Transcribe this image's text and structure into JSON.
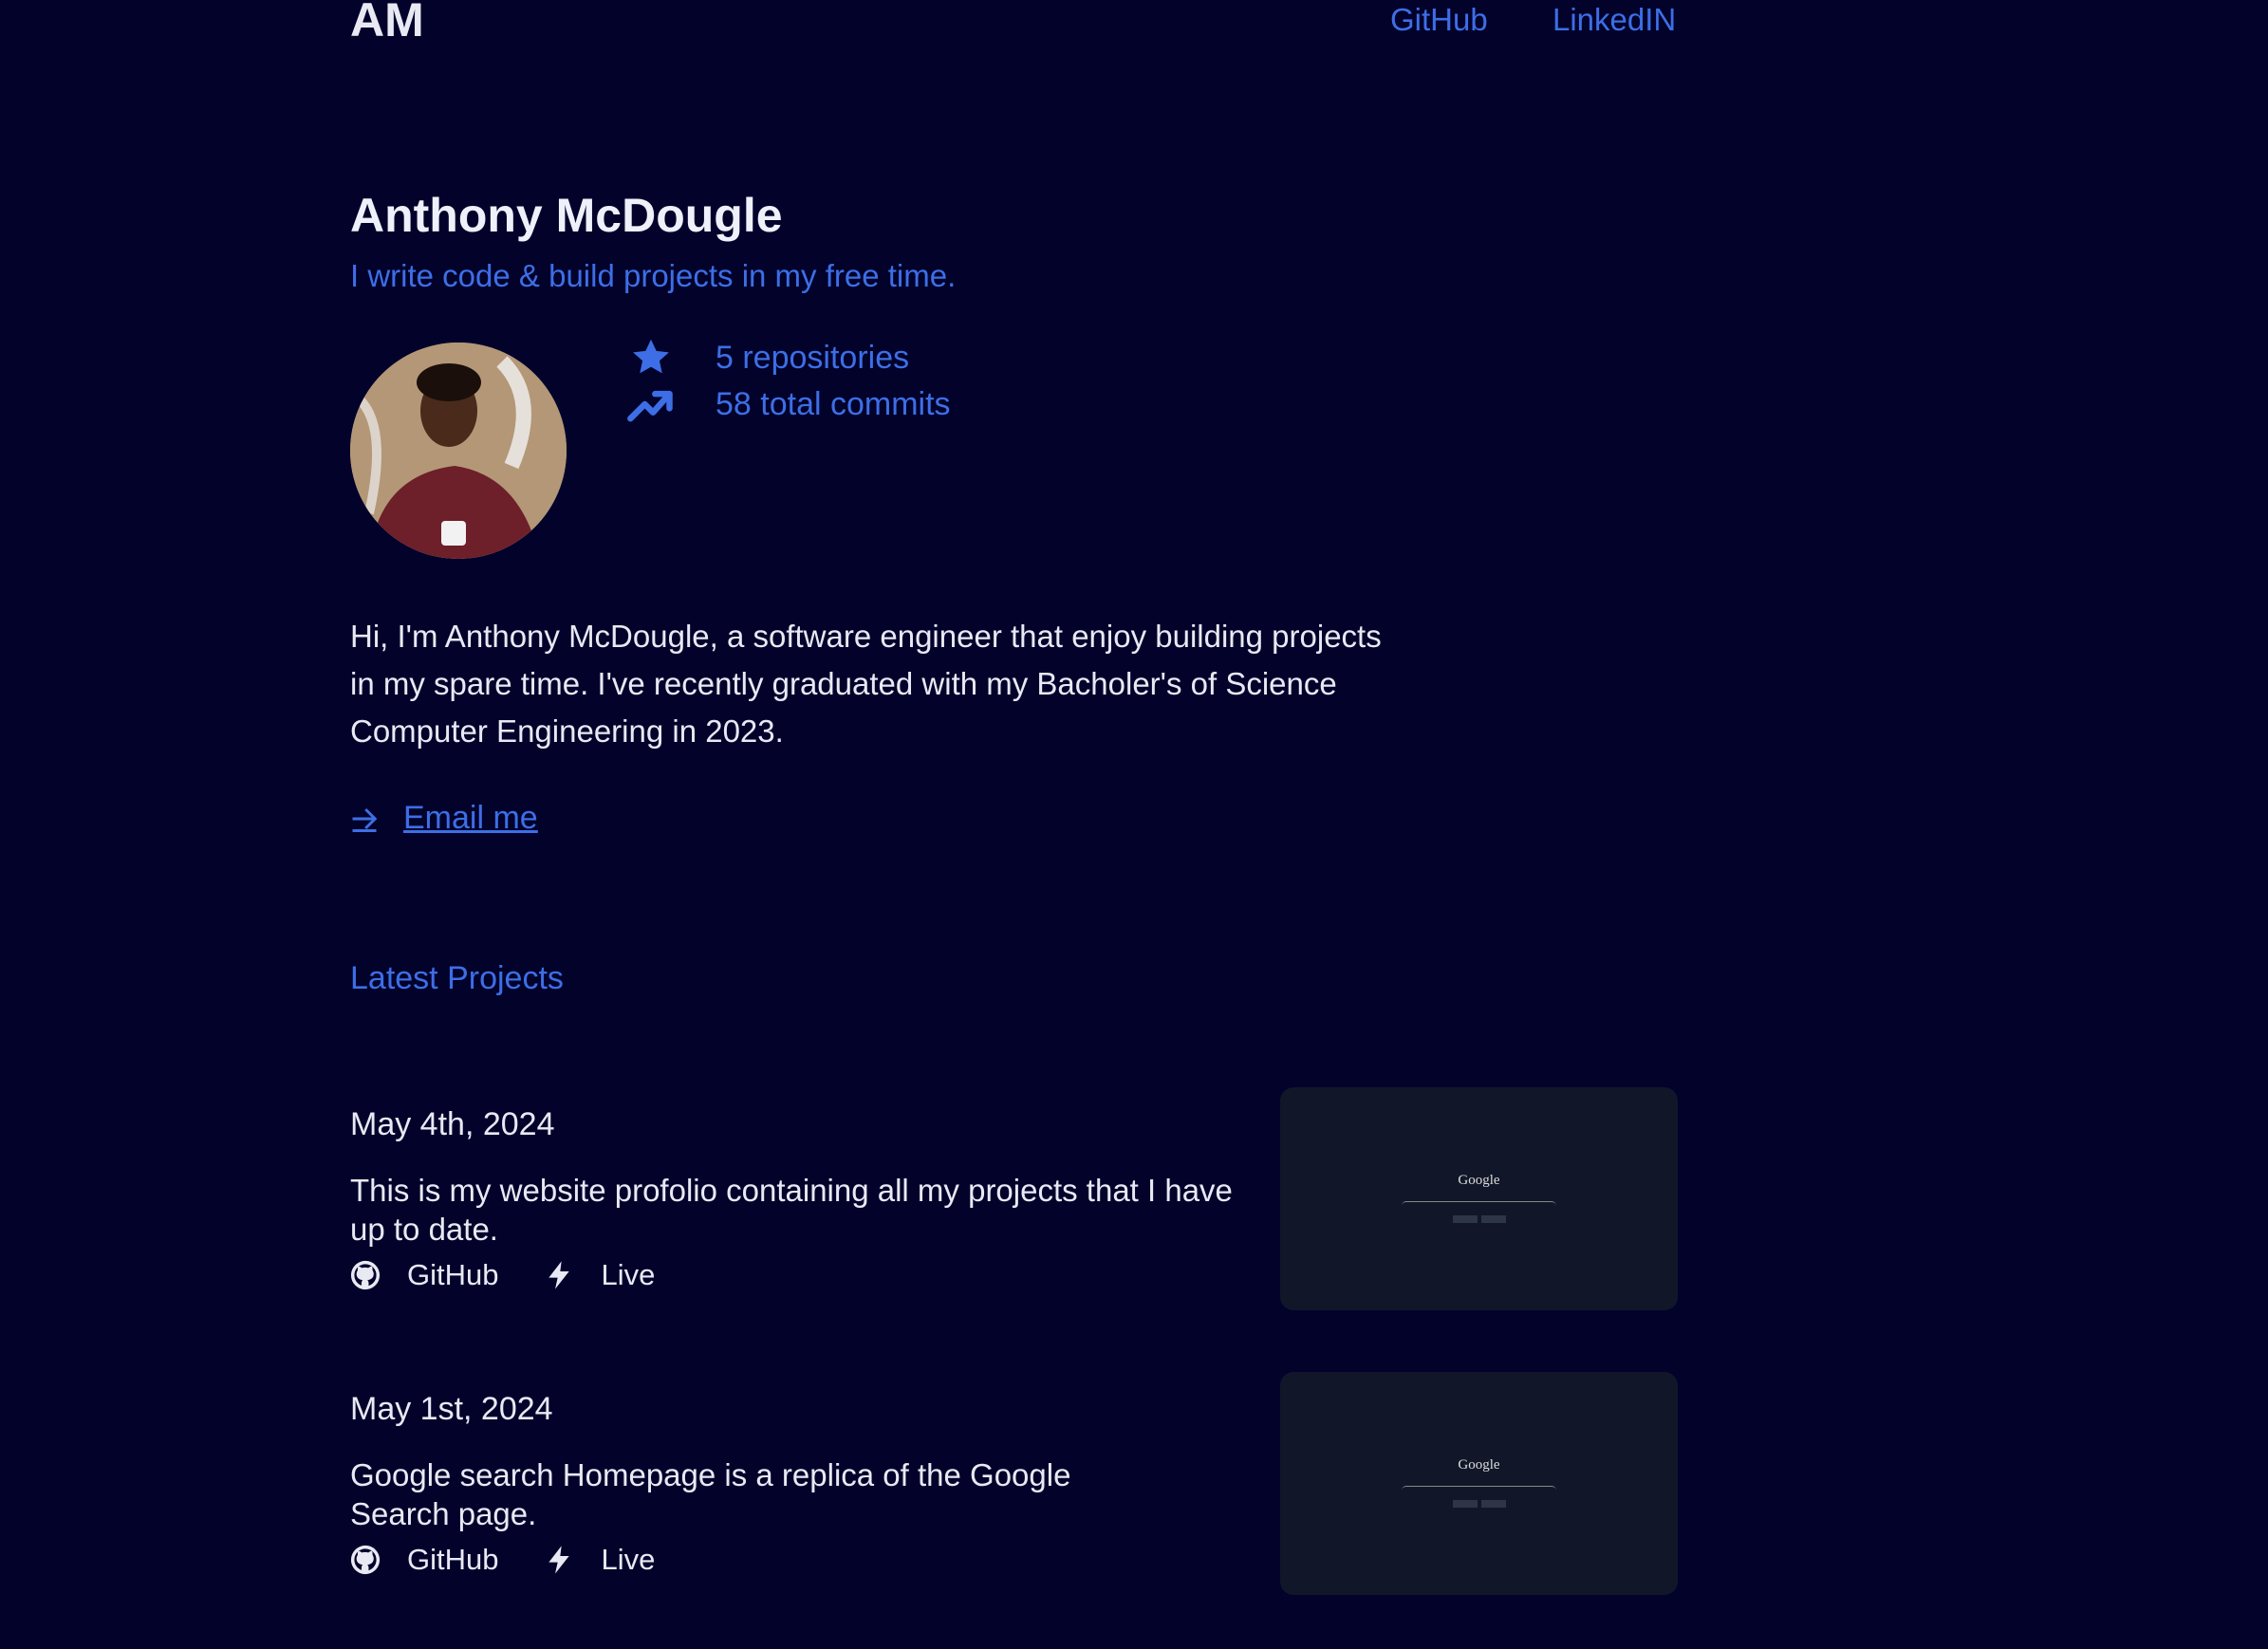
{
  "header": {
    "logo": "AM",
    "nav": [
      {
        "label": "GitHub"
      },
      {
        "label": "LinkedIN"
      }
    ]
  },
  "hero": {
    "name": "Anthony McDougle",
    "tagline": "I write code & build projects in my free time.",
    "stats": [
      {
        "icon": "star-icon",
        "label": "5 repositories"
      },
      {
        "icon": "trending-up-icon",
        "label": "58 total commits"
      }
    ],
    "bio": "Hi, I'm Anthony McDougle, a software engineer that enjoy building projects in my spare time. I've recently graduated with my Bacholer's of Science Computer Engineering in 2023.",
    "email_label": "Email me"
  },
  "colors": {
    "background": "#02022b",
    "accent": "#3d6ee6"
  },
  "projects": {
    "heading": "Latest Projects",
    "items": [
      {
        "date": "May 4th, 2024",
        "description": "This is my website profolio containing all my projects that I have up to date.",
        "github_label": "GitHub",
        "live_label": "Live",
        "thumb_logo": "Google"
      },
      {
        "date": "May 1st, 2024",
        "description": "Google search Homepage is a replica of the Google Search page.",
        "github_label": "GitHub",
        "live_label": "Live",
        "thumb_logo": "Google"
      }
    ]
  }
}
